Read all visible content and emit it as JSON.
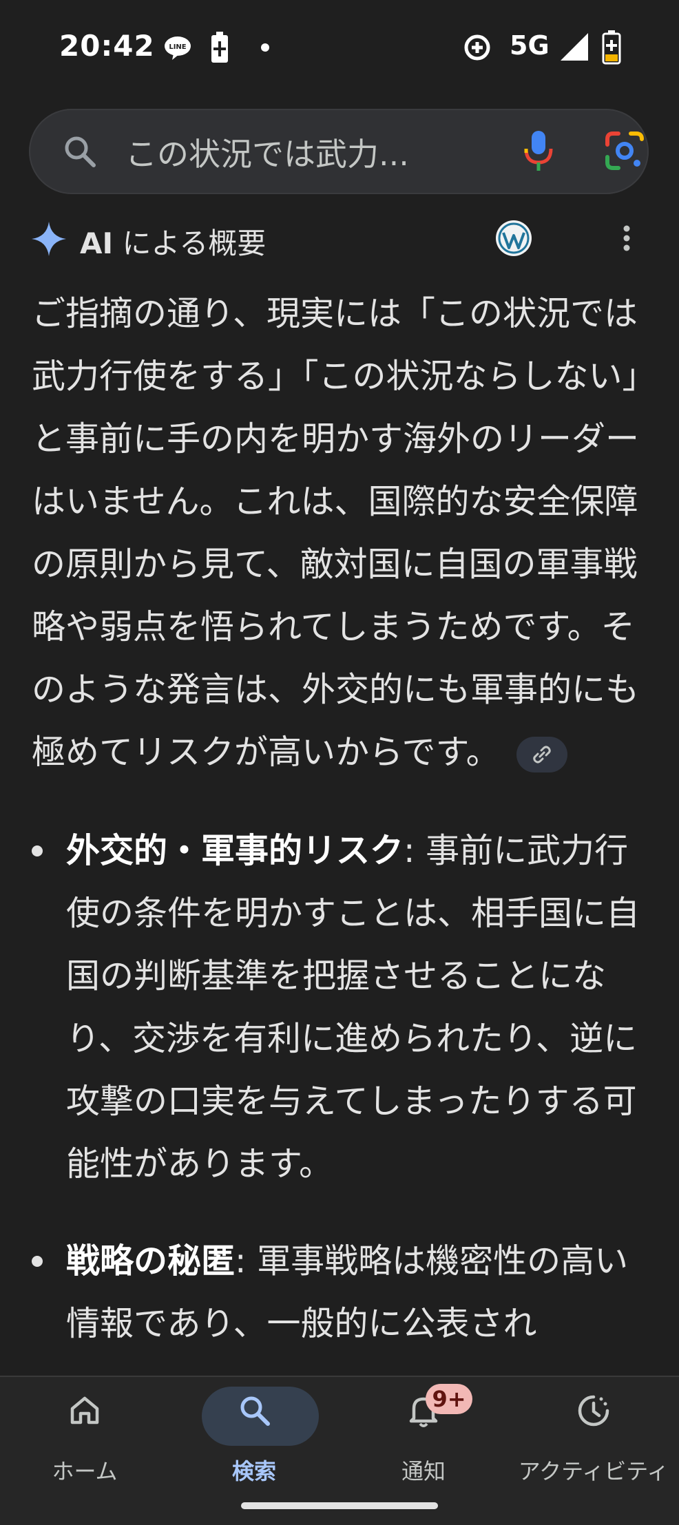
{
  "status_bar": {
    "time": "20:42",
    "network": "5G",
    "icons": [
      "line-icon",
      "battery-saver-icon",
      "dot-icon",
      "data-saver-icon",
      "signal-icon",
      "battery-icon"
    ]
  },
  "search": {
    "query": "この状況では武力..."
  },
  "overview": {
    "ai_label": "AI",
    "title": "による概要",
    "intro": "ご指摘の通り、現実には「この状況では武力行使をする」「この状況ならしない」と事前に手の内を明かす海外のリーダーはいません。これは、国際的な安全保障の原則から見て、敵対国に自国の軍事戦略や弱点を悟られてしまうためです。そのような発言は、外交的にも軍事的にも極めてリスクが高いからです。",
    "bullets": [
      {
        "title": "外交的・軍事的リスク",
        "text": ": 事前に武力行使の条件を明かすことは、相手国に自国の判断基準を把握させることになり、交渉を有利に進められたり、逆に攻撃の口実を与えてしまったりする可能性があります。"
      },
      {
        "title": "戦略の秘匿",
        "text": ": 軍事戦略は機密性の高い情報であり、一般的に公表され"
      }
    ]
  },
  "nav": {
    "items": [
      {
        "label": "ホーム",
        "icon": "home-icon"
      },
      {
        "label": "検索",
        "icon": "search-icon"
      },
      {
        "label": "通知",
        "icon": "bell-icon"
      },
      {
        "label": "アクティビティ",
        "icon": "activity-icon"
      }
    ],
    "badge": "9+"
  },
  "colors": {
    "background": "#1f1f1f",
    "accent": "#a8c7fa",
    "badge": "#f2b8b5"
  }
}
